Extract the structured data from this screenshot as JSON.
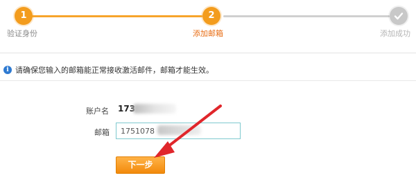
{
  "steps": [
    {
      "number": "1",
      "label": "验证身份",
      "state": "done"
    },
    {
      "number": "2",
      "label": "添加邮箱",
      "state": "current"
    },
    {
      "number": "",
      "label": "添加成功",
      "state": "todo",
      "icon": "check-icon"
    }
  ],
  "notice": {
    "icon": "info-icon",
    "text": "请确保您输入的邮箱能正常接收激活邮件，邮箱才能生效。"
  },
  "form": {
    "username_label": "账户名",
    "username_value": "173",
    "email_label": "邮箱",
    "email_value": "1751078"
  },
  "button": {
    "next_label": "下一步"
  },
  "colors": {
    "accent": "#f39c1d",
    "current_label": "#e86c12",
    "inactive": "#c8c8c8",
    "input_border": "#7ec9cf",
    "annotation_arrow": "#e0262b"
  }
}
